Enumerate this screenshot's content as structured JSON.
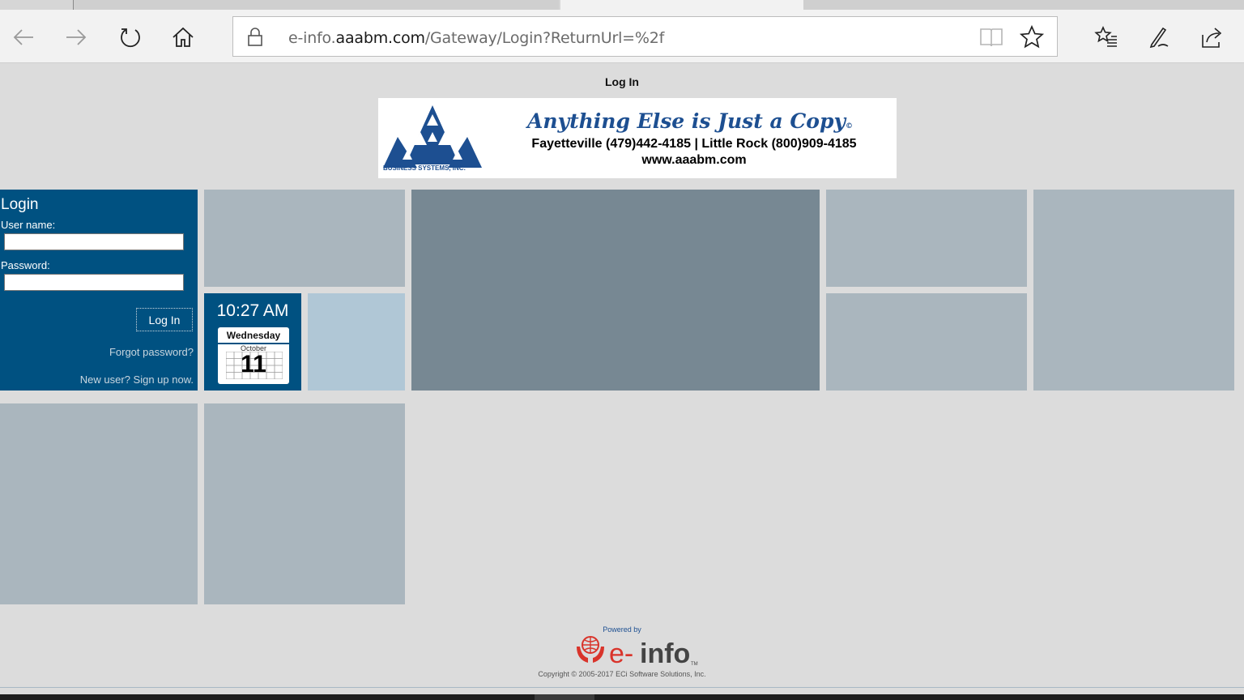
{
  "browser": {
    "address": {
      "url_prefix": "e-info.",
      "url_domain": "aaabm.com",
      "url_path": "/Gateway/Login?ReturnUrl=%2f"
    },
    "icons": [
      "back-icon",
      "forward-icon",
      "refresh-icon",
      "home-icon",
      "lock-icon",
      "reading-view-icon",
      "favorite-star-icon",
      "favorites-hub-icon",
      "web-note-icon",
      "share-icon"
    ]
  },
  "page": {
    "title": "Log In"
  },
  "banner": {
    "slogan": "Anything Else is Just a Copy",
    "slogan_mark": "©",
    "phones": "Fayetteville (479)442-4185 | Little Rock (800)909-4185",
    "website": "www.aaabm.com",
    "company": "BUSINESS SYSTEMS, INC."
  },
  "login": {
    "heading": "Login",
    "username_label": "User name:",
    "username_value": "",
    "password_label": "Password:",
    "password_value": "",
    "submit_label": "Log In",
    "forgot_link": "Forgot password?",
    "signup_link": "New user? Sign up now."
  },
  "clock": {
    "time": "10:27 AM",
    "weekday": "Wednesday",
    "month": "October",
    "day": "11"
  },
  "footer": {
    "powered_by": "Powered by",
    "brand": "e-info",
    "copyright": "Copyright © 2005-2017 ECi Software Solutions, Inc."
  },
  "colors": {
    "tile_primary": "#005181",
    "tile_gray": "#aab6be",
    "tile_dark": "#778893",
    "tile_light": "#b0c7d6",
    "brand_blue": "#1d4f91",
    "brand_red": "#d9342b"
  }
}
